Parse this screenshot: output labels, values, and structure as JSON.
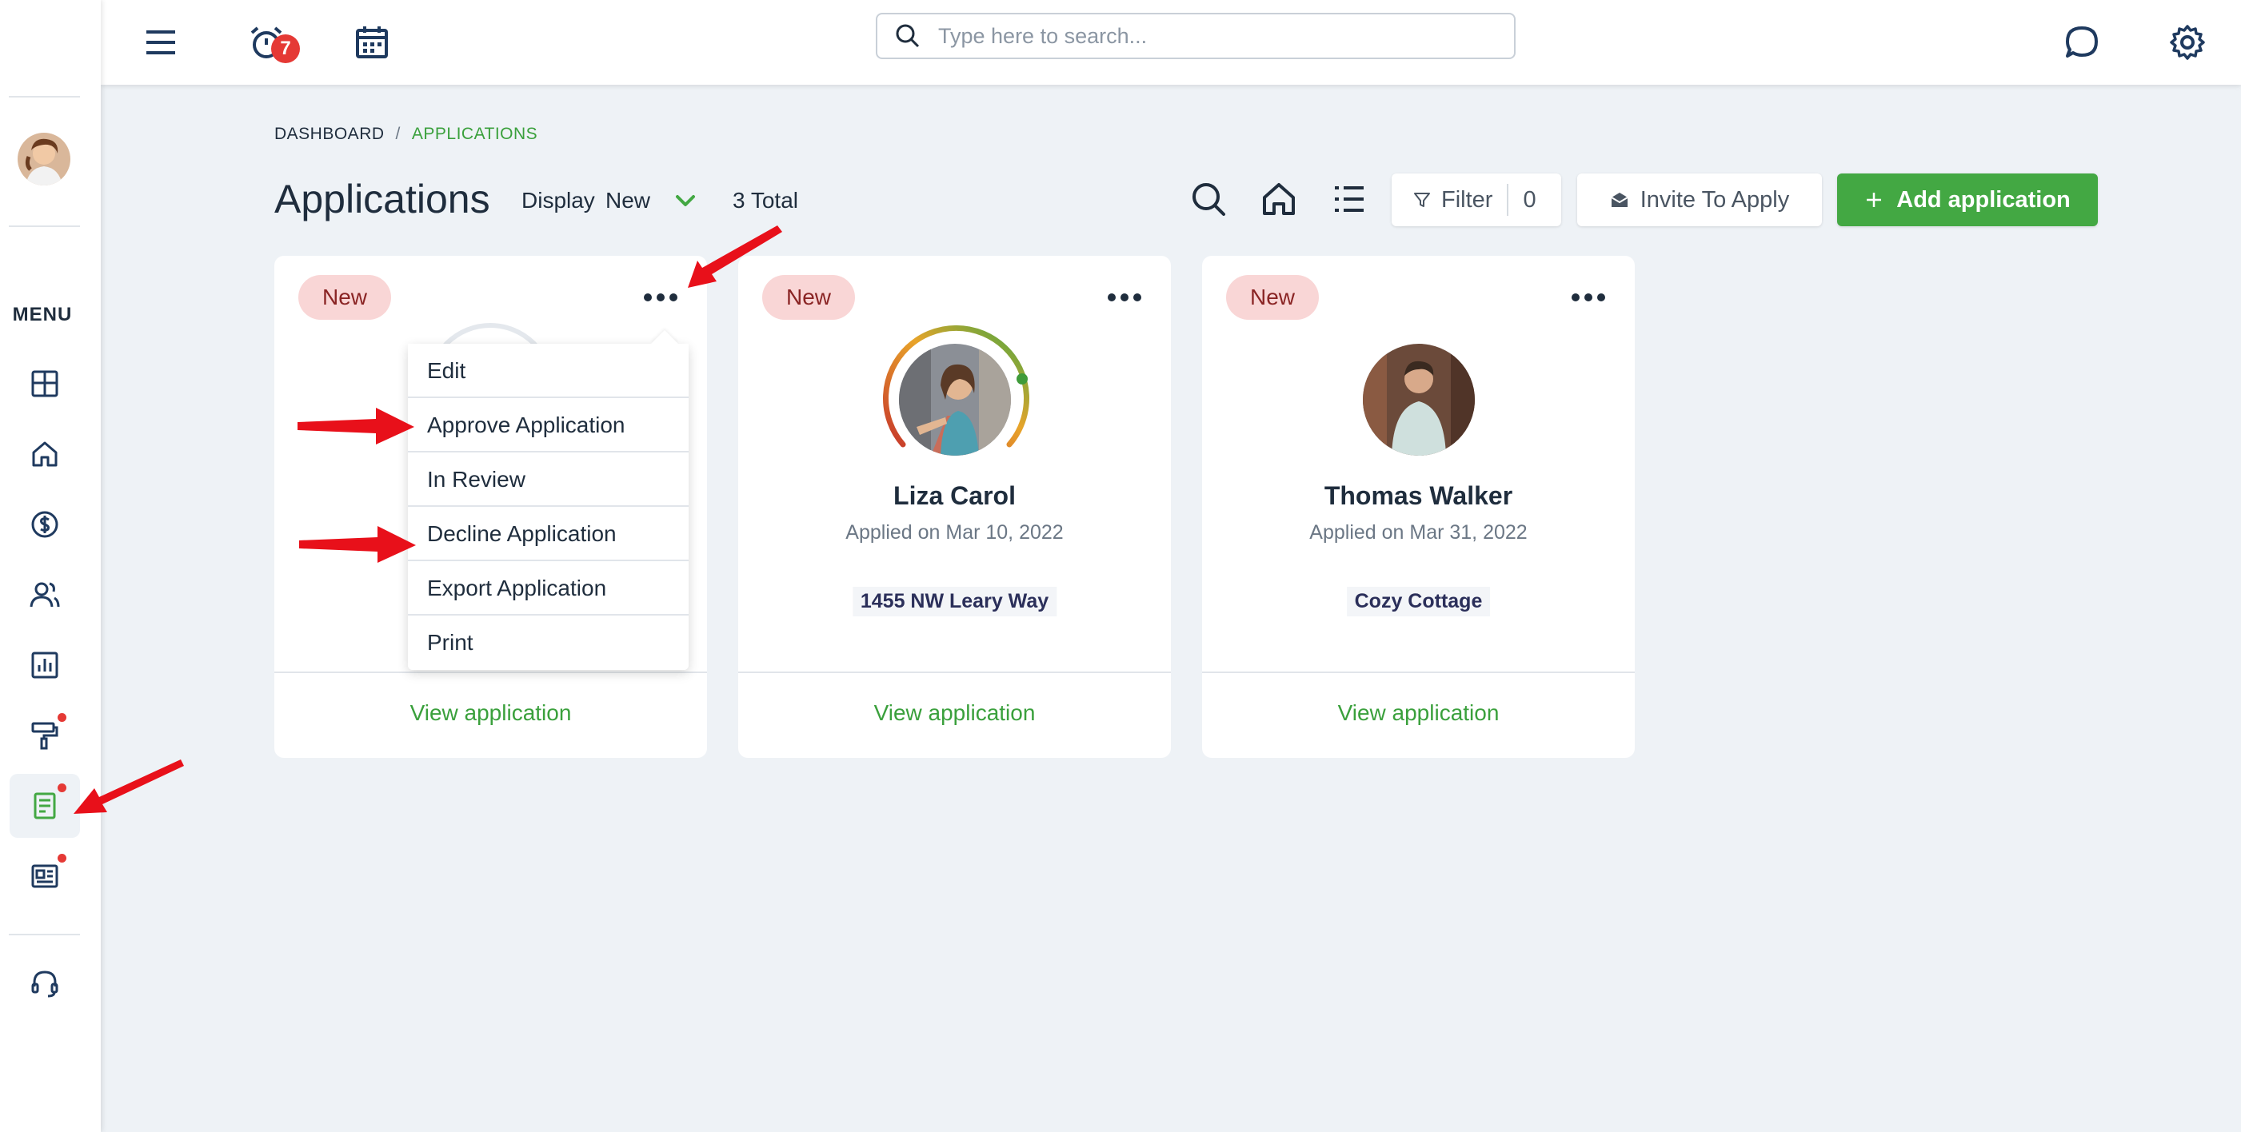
{
  "topbar": {
    "notification_count": "7",
    "search_placeholder": "Type here to search..."
  },
  "sidebar": {
    "menu_label": "MENU",
    "items": [
      {
        "icon": "dashboard-icon"
      },
      {
        "icon": "home-icon"
      },
      {
        "icon": "dollar-icon"
      },
      {
        "icon": "users-icon"
      },
      {
        "icon": "chart-icon"
      },
      {
        "icon": "paint-roller-icon",
        "dot": true
      },
      {
        "icon": "document-icon",
        "dot": true,
        "active": true
      },
      {
        "icon": "newspaper-icon",
        "dot": true
      },
      {
        "icon": "headset-icon"
      }
    ]
  },
  "breadcrumb": {
    "home": "DASHBOARD",
    "separator": "/",
    "current": "APPLICATIONS"
  },
  "header": {
    "title": "Applications",
    "display_label": "Display",
    "display_value": "New",
    "total": "3 Total"
  },
  "toolbar": {
    "filter_label": "Filter",
    "filter_count": "0",
    "invite_label": "Invite To Apply",
    "add_label": "Add application"
  },
  "dropdown": {
    "items": [
      "Edit",
      "Approve Application",
      "In Review",
      "Decline Application",
      "Export Application",
      "Print"
    ]
  },
  "cards": [
    {
      "badge": "New",
      "name": "",
      "applied": "",
      "property": "",
      "view_label": "View application"
    },
    {
      "badge": "New",
      "name": "Liza Carol",
      "applied": "Applied on Mar 10, 2022",
      "property": "1455 NW Leary Way",
      "view_label": "View application"
    },
    {
      "badge": "New",
      "name": "Thomas Walker",
      "applied": "Applied on Mar 31, 2022",
      "property": "Cozy Cottage",
      "view_label": "View application"
    }
  ],
  "colors": {
    "accent_green": "#43a843",
    "badge_bg": "#f9d6d6",
    "badge_text": "#8a2424",
    "notification_red": "#e53935",
    "annotation_red": "#e8101a"
  }
}
